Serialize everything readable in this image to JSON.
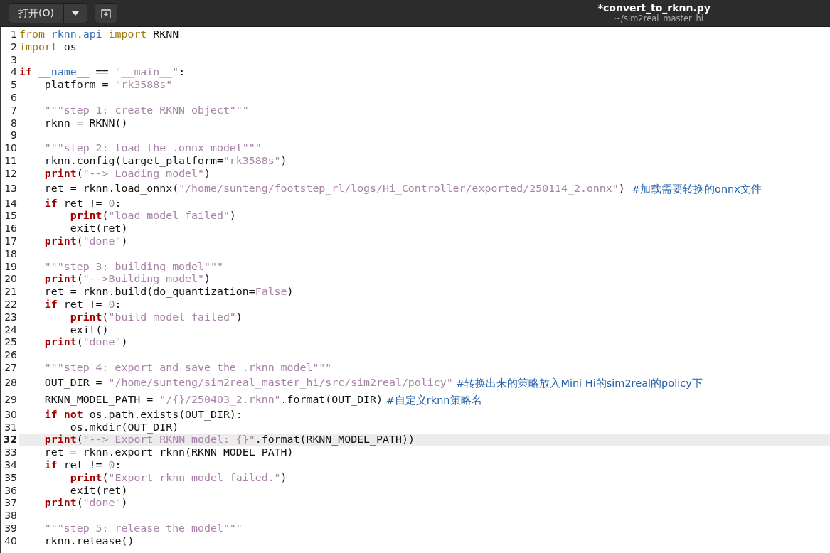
{
  "header": {
    "open_button": "打开(O)",
    "title": "*convert_to_rknn.py",
    "subtitle": "~/sim2real_master_hi"
  },
  "lines": [
    {
      "number": "1",
      "current": false,
      "tokens": [
        {
          "kind": "keyword",
          "text": "from"
        },
        {
          "kind": "builtin",
          "text": " rknn.api"
        },
        {
          "kind": "keyword",
          "text": " import"
        },
        {
          "kind": "plain",
          "text": " RKNN"
        }
      ]
    },
    {
      "number": "2",
      "current": false,
      "tokens": [
        {
          "kind": "keyword",
          "text": "import"
        },
        {
          "kind": "plain",
          "text": " os"
        }
      ]
    },
    {
      "number": "3",
      "current": false
    },
    {
      "number": "4",
      "current": false,
      "tokens": [
        {
          "kind": "control",
          "text": "if"
        },
        {
          "kind": "builtin",
          "text": " __name__"
        },
        {
          "kind": "plain",
          "text": " == "
        },
        {
          "kind": "string",
          "text": "\"__main__\""
        },
        {
          "kind": "plain",
          "text": ":"
        }
      ]
    },
    {
      "number": "5",
      "current": false,
      "tokens": [
        {
          "kind": "plain",
          "text": "    platform = "
        },
        {
          "kind": "string",
          "text": "\"rk3588s\""
        }
      ]
    },
    {
      "number": "6",
      "current": false
    },
    {
      "number": "7",
      "current": false,
      "tokens": [
        {
          "kind": "string",
          "text": "    \"\"\"step 1: create RKNN object\"\"\""
        }
      ]
    },
    {
      "number": "8",
      "current": false,
      "tokens": [
        {
          "kind": "plain",
          "text": "    rknn = RKNN()"
        }
      ]
    },
    {
      "number": "9",
      "current": false
    },
    {
      "number": "10",
      "current": false,
      "tokens": [
        {
          "kind": "string",
          "text": "    \"\"\"step 2: load the .onnx model\"\"\""
        }
      ]
    },
    {
      "number": "11",
      "current": false,
      "tokens": [
        {
          "kind": "plain",
          "text": "    rknn.config(target_platform="
        },
        {
          "kind": "string",
          "text": "\"rk3588s\""
        },
        {
          "kind": "plain",
          "text": ")"
        }
      ]
    },
    {
      "number": "12",
      "current": false,
      "tokens": [
        {
          "kind": "control",
          "text": "    print"
        },
        {
          "kind": "plain",
          "text": "("
        },
        {
          "kind": "string",
          "text": "\"--> Loading model\""
        },
        {
          "kind": "plain",
          "text": ")"
        }
      ]
    },
    {
      "number": "13",
      "current": false,
      "tokens": [
        {
          "kind": "plain",
          "text": "    ret = rknn.load_onnx("
        },
        {
          "kind": "string",
          "text": "\"/home/sunteng/footstep_rl/logs/Hi_Controller/exported/250114_2.onnx\""
        },
        {
          "kind": "plain",
          "text": ")"
        },
        {
          "kind": "comment",
          "text": "  #加载需要转换的onnx文件"
        }
      ]
    },
    {
      "number": "14",
      "current": false,
      "tokens": [
        {
          "kind": "control",
          "text": "    if"
        },
        {
          "kind": "plain",
          "text": " ret != "
        },
        {
          "kind": "number",
          "text": "0"
        },
        {
          "kind": "plain",
          "text": ":"
        }
      ]
    },
    {
      "number": "15",
      "current": false,
      "tokens": [
        {
          "kind": "control",
          "text": "        print"
        },
        {
          "kind": "plain",
          "text": "("
        },
        {
          "kind": "string",
          "text": "\"load model failed\""
        },
        {
          "kind": "plain",
          "text": ")"
        }
      ]
    },
    {
      "number": "16",
      "current": false,
      "tokens": [
        {
          "kind": "plain",
          "text": "        exit(ret)"
        }
      ]
    },
    {
      "number": "17",
      "current": false,
      "tokens": [
        {
          "kind": "control",
          "text": "    print"
        },
        {
          "kind": "plain",
          "text": "("
        },
        {
          "kind": "string",
          "text": "\"done\""
        },
        {
          "kind": "plain",
          "text": ")"
        }
      ]
    },
    {
      "number": "18",
      "current": false
    },
    {
      "number": "19",
      "current": false,
      "tokens": [
        {
          "kind": "string",
          "text": "    \"\"\"step 3: building model\"\"\""
        }
      ]
    },
    {
      "number": "20",
      "current": false,
      "tokens": [
        {
          "kind": "control",
          "text": "    print"
        },
        {
          "kind": "plain",
          "text": "("
        },
        {
          "kind": "string",
          "text": "\"-->Building model\""
        },
        {
          "kind": "plain",
          "text": ")"
        }
      ]
    },
    {
      "number": "21",
      "current": false,
      "tokens": [
        {
          "kind": "plain",
          "text": "    ret = rknn.build(do_quantization="
        },
        {
          "kind": "number",
          "text": "False"
        },
        {
          "kind": "plain",
          "text": ")"
        }
      ]
    },
    {
      "number": "22",
      "current": false,
      "tokens": [
        {
          "kind": "control",
          "text": "    if"
        },
        {
          "kind": "plain",
          "text": " ret != "
        },
        {
          "kind": "number",
          "text": "0"
        },
        {
          "kind": "plain",
          "text": ":"
        }
      ]
    },
    {
      "number": "23",
      "current": false,
      "tokens": [
        {
          "kind": "control",
          "text": "        print"
        },
        {
          "kind": "plain",
          "text": "("
        },
        {
          "kind": "string",
          "text": "\"build model failed\""
        },
        {
          "kind": "plain",
          "text": ")"
        }
      ]
    },
    {
      "number": "24",
      "current": false,
      "tokens": [
        {
          "kind": "plain",
          "text": "        exit()"
        }
      ]
    },
    {
      "number": "25",
      "current": false,
      "tokens": [
        {
          "kind": "control",
          "text": "    print"
        },
        {
          "kind": "plain",
          "text": "("
        },
        {
          "kind": "string",
          "text": "\"done\""
        },
        {
          "kind": "plain",
          "text": ")"
        }
      ]
    },
    {
      "number": "26",
      "current": false
    },
    {
      "number": "27",
      "current": false,
      "tokens": [
        {
          "kind": "string",
          "text": "    \"\"\"step 4: export and save the .rknn model\"\"\""
        }
      ]
    },
    {
      "number": "28",
      "current": false,
      "tokens": [
        {
          "kind": "plain",
          "text": "    OUT_DIR = "
        },
        {
          "kind": "string",
          "text": "\"/home/sunteng/sim2real_master_hi/src/sim2real/policy\""
        },
        {
          "kind": "comment",
          "text": " #转换出来的策略放入Mini Hi的sim2real的policy下"
        }
      ]
    },
    {
      "number": "29",
      "current": false,
      "tokens": [
        {
          "kind": "plain",
          "text": "    RKNN_MODEL_PATH = "
        },
        {
          "kind": "string",
          "text": "\"/{}/250403_2.rknn\""
        },
        {
          "kind": "plain",
          "text": ".format(OUT_DIR)"
        },
        {
          "kind": "comment",
          "text": " #自定义rknn策略名"
        }
      ]
    },
    {
      "number": "30",
      "current": false,
      "tokens": [
        {
          "kind": "control",
          "text": "    if"
        },
        {
          "kind": "control",
          "text": " not"
        },
        {
          "kind": "plain",
          "text": " os.path.exists(OUT_DIR):"
        }
      ]
    },
    {
      "number": "31",
      "current": false,
      "tokens": [
        {
          "kind": "plain",
          "text": "        os.mkdir(OUT_DIR)"
        }
      ]
    },
    {
      "number": "32",
      "current": true,
      "tokens": [
        {
          "kind": "control",
          "text": "    print"
        },
        {
          "kind": "plain",
          "text": "("
        },
        {
          "kind": "string",
          "text": "\"--> Export RKNN model: {}\""
        },
        {
          "kind": "plain",
          "text": ".format(RKNN_MODEL_PATH))"
        }
      ]
    },
    {
      "number": "33",
      "current": false,
      "tokens": [
        {
          "kind": "plain",
          "text": "    ret = rknn.export_rknn(RKNN_MODEL_PATH)"
        }
      ]
    },
    {
      "number": "34",
      "current": false,
      "tokens": [
        {
          "kind": "control",
          "text": "    if"
        },
        {
          "kind": "plain",
          "text": " ret != "
        },
        {
          "kind": "number",
          "text": "0"
        },
        {
          "kind": "plain",
          "text": ":"
        }
      ]
    },
    {
      "number": "35",
      "current": false,
      "tokens": [
        {
          "kind": "control",
          "text": "        print"
        },
        {
          "kind": "plain",
          "text": "("
        },
        {
          "kind": "string",
          "text": "\"Export rknn model failed.\""
        },
        {
          "kind": "plain",
          "text": ")"
        }
      ]
    },
    {
      "number": "36",
      "current": false,
      "tokens": [
        {
          "kind": "plain",
          "text": "        exit(ret)"
        }
      ]
    },
    {
      "number": "37",
      "current": false,
      "tokens": [
        {
          "kind": "control",
          "text": "    print"
        },
        {
          "kind": "plain",
          "text": "("
        },
        {
          "kind": "string",
          "text": "\"done\""
        },
        {
          "kind": "plain",
          "text": ")"
        }
      ]
    },
    {
      "number": "38",
      "current": false
    },
    {
      "number": "39",
      "current": false,
      "tokens": [
        {
          "kind": "string",
          "text": "    \"\"\"step 5: release the model\"\"\""
        }
      ]
    },
    {
      "number": "40",
      "current": false,
      "tokens": [
        {
          "kind": "plain",
          "text": "    rknn.release()"
        }
      ]
    }
  ]
}
